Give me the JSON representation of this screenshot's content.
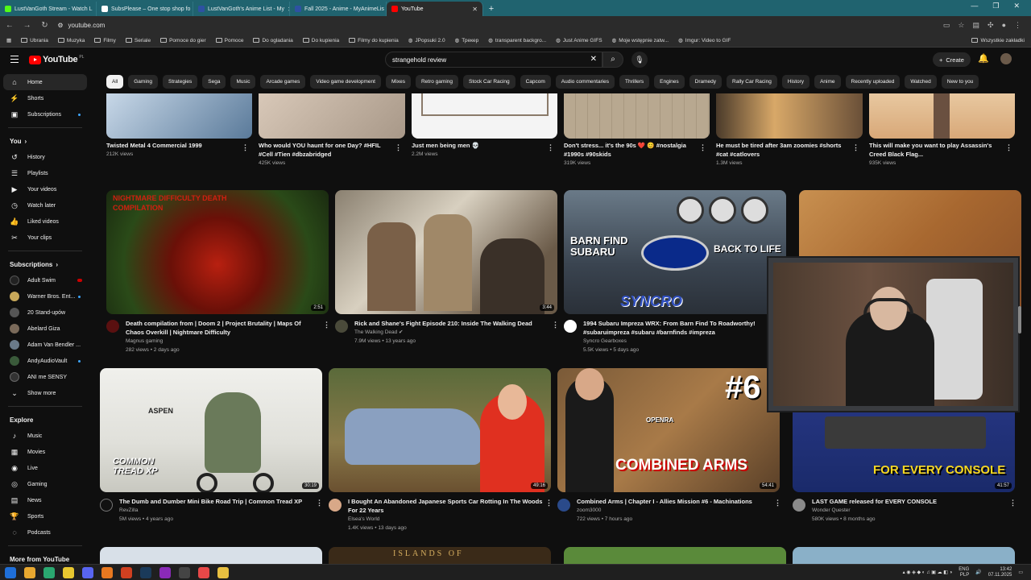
{
  "browser": {
    "tabs": [
      {
        "label": "LustVanGoth Stream - Watch L",
        "color": "#53fc18"
      },
      {
        "label": "SubsPlease – One stop shop fo",
        "color": "#ffffff"
      },
      {
        "label": "LustVanGoth's Anime List - My",
        "color": "#2e51a2"
      },
      {
        "label": "Fall 2025 - Anime - MyAnimeLis",
        "color": "#2e51a2"
      },
      {
        "label": "YouTube",
        "color": "#ff0000"
      }
    ],
    "url": "youtube.com",
    "bookmarks": [
      "Ubrania",
      "Muzyka",
      "Filmy",
      "Seriale",
      "Pomoce do gier",
      "Pomoce",
      "Do ogladania",
      "Do kupienia",
      "Filmy do kupienia",
      "JPopsuki 2.0",
      "Трекер",
      "transparent backgro...",
      "Just Anime GIFS",
      "Moje wstępnie zatw...",
      "Imgur: Video to GIF"
    ],
    "all_bookmarks": "Wszystkie zakładki"
  },
  "youtube": {
    "logo": "YouTube",
    "logo_cc": "PL",
    "search_query": "strangehold review",
    "create_label": "Create",
    "chips": [
      "All",
      "Gaming",
      "Strategies",
      "Sega",
      "Music",
      "Arcade games",
      "Video game development",
      "Mixes",
      "Retro gaming",
      "Stock Car Racing",
      "Capcom",
      "Audio commentaries",
      "Thrillers",
      "Engines",
      "Dramedy",
      "Rally Car Racing",
      "History",
      "Anime",
      "Recently uploaded",
      "Watched",
      "New to you"
    ]
  },
  "sidebar": {
    "main": [
      "Home",
      "Shorts",
      "Subscriptions"
    ],
    "you_header": "You",
    "you": [
      "History",
      "Playlists",
      "Your videos",
      "Watch later",
      "Liked videos",
      "Your clips"
    ],
    "subs_header": "Subscriptions",
    "subs": [
      {
        "name": "Adult Swim",
        "color": "#222",
        "badge": "live"
      },
      {
        "name": "Warner Bros. Ent...",
        "color": "#c8a85a",
        "badge": "dot"
      },
      {
        "name": "20 Stand-upów",
        "color": "#555",
        "badge": ""
      },
      {
        "name": "Abelard Giza",
        "color": "#7a6a5a",
        "badge": ""
      },
      {
        "name": "Adam Van Bendler ...",
        "color": "#6a7a8a",
        "badge": ""
      },
      {
        "name": "AndyAudioVault",
        "color": "#3a5a3a",
        "badge": "dot"
      },
      {
        "name": "ANI me SENSY",
        "color": "#333",
        "badge": ""
      }
    ],
    "show_more": "Show more",
    "explore_header": "Explore",
    "explore": [
      "Music",
      "Movies",
      "Live",
      "Gaming",
      "News",
      "Sports",
      "Podcasts"
    ],
    "more_header": "More from YouTube"
  },
  "shorts": [
    {
      "title": "Twisted Metal 4 Commercial 1999",
      "meta": "212K views"
    },
    {
      "title": "Who would YOU haunt for one Day? #HFIL #Cell #Tien #dbzabridged",
      "meta": "425K views"
    },
    {
      "title": "Just men being men 💀",
      "meta": "2.2M views"
    },
    {
      "title": "Don't stress... it's the 90s ❤️ 😊 #nostalgia #1990s #90skids",
      "meta": "319K views"
    },
    {
      "title": "He must be tired after 3am zoomies #shorts #cat #catlovers",
      "meta": "1.3M views"
    },
    {
      "title": "This will make you want to play Assassin's Creed Black Flag...",
      "meta": "935K views"
    }
  ],
  "row1": [
    {
      "title": "Death compilation from | Doom 2 | Project Brutality | Maps Of Chaos Overkill | Nightmare Difficulty",
      "channel": "Magnus gaming",
      "meta": "282 views • 2 days ago",
      "duration": "2:51",
      "thumb_text": "NIGHTMARE DIFFICULTY DEATH COMPILATION"
    },
    {
      "title": "Rick and Shane's Fight Episode 210: Inside The Walking Dead",
      "channel": "The Walking Dead ✔",
      "meta": "7.9M views • 13 years ago",
      "duration": "3:44"
    },
    {
      "title": "1994 Subaru Impreza WRX: From Barn Find To Roadworthy! #subaruimpreza #subaru #barnfinds #impreza",
      "channel": "Syncro Gearboxes",
      "meta": "5.5K views • 5 days ago",
      "duration": "",
      "thumb_text": "BARN FIND SUBARU",
      "thumb_text2": "BACK TO LIFE",
      "thumb_text3": "SYNCRO"
    }
  ],
  "row2": [
    {
      "title": "The Dumb and Dumber Mini Bike Road Trip | Common Tread XP",
      "channel": "RevZilla",
      "meta": "5M views • 4 years ago",
      "duration": "30:19",
      "thumb_text": "ASPEN",
      "thumb_text2": "COMMON TREAD XP"
    },
    {
      "title": "I Bought An Abandoned Japanese Sports Car Rotting In The Woods For 22 Years",
      "channel": "Elsea's World",
      "meta": "1.4K views • 13 days ago",
      "duration": "49:16"
    },
    {
      "title": "Combined Arms | Chapter I - Allies Mission #6 - Machinations",
      "channel": "zoom3000",
      "meta": "722 views • 7 hours ago",
      "duration": "54:41",
      "thumb_text": "COMBINED ARMS",
      "thumb_text2": "OPENRA",
      "thumb_text3": "#6"
    },
    {
      "title": "LAST GAME released for EVERY CONSOLE",
      "channel": "Wonder Quester",
      "meta": "580K views • 8 months ago",
      "duration": "41:57",
      "thumb_text": "FOR EVERY CONSOLE",
      "thumb_text2": "LUSTVANGOTH"
    }
  ],
  "row3_thumb_text": "ISLANDS OF",
  "taskbar": {
    "lang1": "ENG",
    "lang2": "PLP",
    "time": "13:42",
    "date": "07.11.2025"
  }
}
